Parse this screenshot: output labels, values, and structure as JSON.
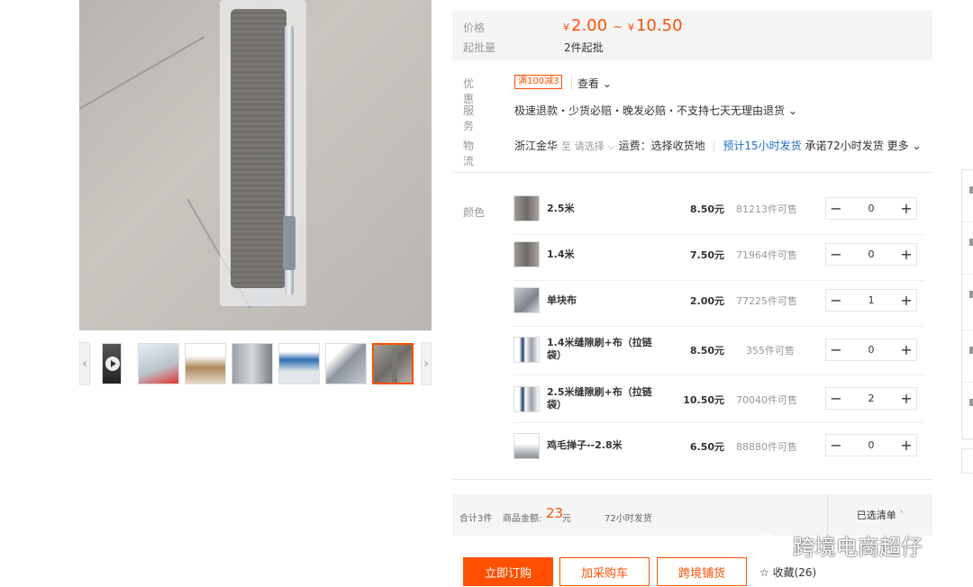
{
  "price": {
    "label": "价格",
    "currency": "¥",
    "min": "2.00",
    "tilde": "~",
    "max": "10.50",
    "moq_label": "起批量",
    "moq_value": "2件起批"
  },
  "promotion": {
    "label": "优惠",
    "coupon": "满100减3",
    "view_more": "查看"
  },
  "service": {
    "label": "服务",
    "text": "极速退款・少货必赔・晚发必赔・不支持七天无理由退货"
  },
  "logistics": {
    "label": "物流",
    "origin": "浙江金华",
    "to": "至",
    "select_dest": "请选择",
    "freight": "运费：选择收货地",
    "eta": "预计15小时发货",
    "promise": "承诺72小时发货",
    "more": "更多"
  },
  "sku": {
    "label": "颜色",
    "items": [
      {
        "name": "2.5米",
        "price": "8.50元",
        "stock": "81213件可售",
        "qty": "0"
      },
      {
        "name": "1.4米",
        "price": "7.50元",
        "stock": "71964件可售",
        "qty": "0"
      },
      {
        "name": "单块布",
        "price": "2.00元",
        "stock": "77225件可售",
        "qty": "1"
      },
      {
        "name": "1.4米缝隙刷+布（拉链袋）",
        "price": "8.50元",
        "stock": "355件可售",
        "qty": "0"
      },
      {
        "name": "2.5米缝隙刷+布（拉链袋）",
        "price": "10.50元",
        "stock": "70040件可售",
        "qty": "2"
      },
      {
        "name": "鸡毛掸子--2.8米",
        "price": "6.50元",
        "stock": "88880件可售",
        "qty": "0"
      }
    ],
    "minus": "−",
    "plus": "+"
  },
  "summary": {
    "total_count": "合计3件",
    "amount_label": "商品金额:",
    "amount": "23",
    "amount_unit": "元",
    "ship": "72小时发货",
    "selected_list": "已选清单"
  },
  "actions": {
    "buy_now": "立即订购",
    "add_cart": "加采购车",
    "cross_border": "跨境铺货",
    "favorite": "收藏(26)"
  },
  "watermark": "跨境电商超仔",
  "colors": {
    "accent": "#ff5000",
    "link": "#1a6ecf"
  }
}
